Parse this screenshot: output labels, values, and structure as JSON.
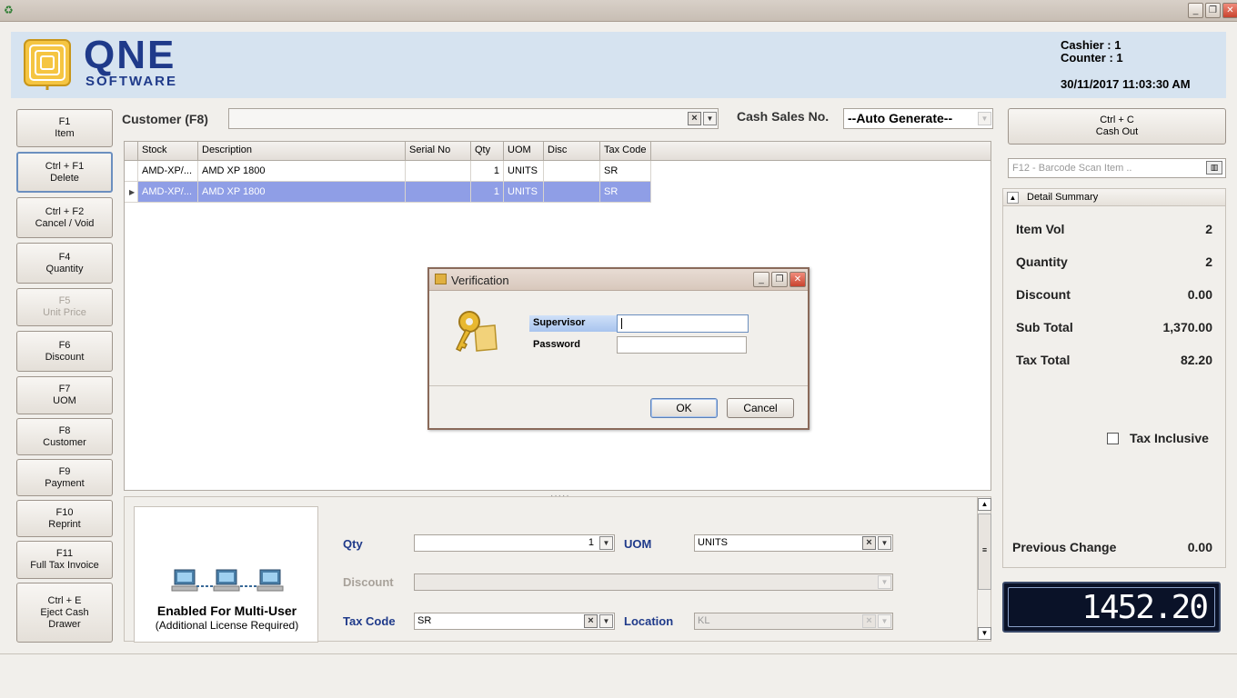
{
  "window": {
    "minimize": "_",
    "restore": "❐",
    "close": "✕"
  },
  "header": {
    "logo_text": "QNE",
    "logo_sub": "SOFTWARE",
    "cashier": "Cashier : 1",
    "counter": "Counter : 1",
    "datetime": "30/11/2017 11:03:30 AM"
  },
  "function_buttons": [
    {
      "key": "F1",
      "label": "Item"
    },
    {
      "key": "Ctrl + F1",
      "label": "Delete"
    },
    {
      "key": "Ctrl + F2",
      "label": "Cancel / Void"
    },
    {
      "key": "F4",
      "label": "Quantity"
    },
    {
      "key": "F5",
      "label": "Unit Price"
    },
    {
      "key": "F6",
      "label": "Discount"
    },
    {
      "key": "F7",
      "label": "UOM"
    },
    {
      "key": "F8",
      "label": "Customer"
    },
    {
      "key": "F9",
      "label": "Payment"
    },
    {
      "key": "F10",
      "label": "Reprint"
    },
    {
      "key": "F11",
      "label": "Full Tax Invoice"
    },
    {
      "key": "Ctrl + E",
      "label": "Eject Cash",
      "label2": "Drawer"
    }
  ],
  "customer": {
    "label": "Customer (F8)",
    "value": ""
  },
  "cash_sales": {
    "label": "Cash Sales No.",
    "value": "--Auto Generate--"
  },
  "grid": {
    "columns": [
      "Stock",
      "Description",
      "Serial No",
      "Qty",
      "UOM",
      "Disc",
      "Tax Code"
    ],
    "rows": [
      {
        "stock": "AMD-XP/...",
        "description": "AMD XP 1800",
        "serial": "",
        "qty": "1",
        "uom": "UNITS",
        "disc": "",
        "tax": "SR"
      },
      {
        "stock": "AMD-XP/...",
        "description": "AMD XP 1800",
        "serial": "",
        "qty": "1",
        "uom": "UNITS",
        "disc": "",
        "tax": "SR"
      }
    ]
  },
  "bottom": {
    "multi_title": "Enabled For Multi-User",
    "multi_sub": "(Additional License Required)",
    "qty_label": "Qty",
    "qty_value": "1",
    "uom_label": "UOM",
    "uom_value": "UNITS",
    "discount_label": "Discount",
    "discount_value": "",
    "taxcode_label": "Tax Code",
    "taxcode_value": "SR",
    "location_label": "Location",
    "location_value": "KL"
  },
  "right": {
    "cashout_key": "Ctrl + C",
    "cashout_label": "Cash Out",
    "barcode_placeholder": "F12 - Barcode Scan Item ..",
    "summary_title": "Detail Summary",
    "summary": [
      {
        "label": "Item Vol",
        "value": "2"
      },
      {
        "label": "Quantity",
        "value": "2"
      },
      {
        "label": "Discount",
        "value": "0.00"
      },
      {
        "label": "Sub Total",
        "value": "1,370.00"
      },
      {
        "label": "Tax Total",
        "value": "82.20"
      }
    ],
    "tax_inclusive_label": "Tax Inclusive",
    "previous_change_label": "Previous Change",
    "previous_change_value": "0.00",
    "lcd_total": "1452.20"
  },
  "dialog": {
    "title": "Verification",
    "supervisor_label": "Supervisor",
    "supervisor_value": "",
    "password_label": "Password",
    "ok_label": "OK",
    "cancel_label": "Cancel"
  },
  "colors": {
    "brand": "#1f3a8a",
    "selection": "#8f9ee6",
    "header_bg": "#d6e3f0"
  }
}
